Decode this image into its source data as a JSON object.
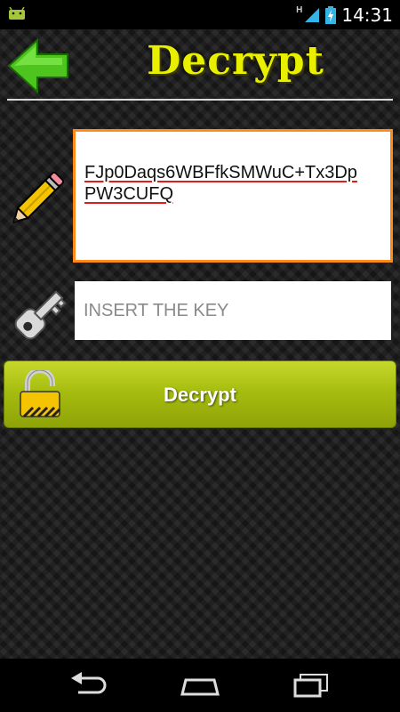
{
  "status_bar": {
    "network_type": "H",
    "time": "14:31",
    "icons": [
      "android-icon",
      "signal-icon",
      "battery-charging-icon"
    ]
  },
  "header": {
    "title": "Decrypt",
    "back_icon": "back-arrow-icon"
  },
  "cipher": {
    "icon": "pencil-icon",
    "lines": [
      "FJp0Daqs6WBFfkSMWuC+Tx3Dp",
      "PW3CUFQ"
    ]
  },
  "key": {
    "icon": "key-icon",
    "value": "",
    "placeholder": "INSERT THE KEY"
  },
  "decrypt_button": {
    "label": "Decrypt",
    "icon": "padlock-open-icon"
  },
  "nav_bar": {
    "items": [
      "back-icon",
      "home-icon",
      "recent-apps-icon"
    ]
  },
  "colors": {
    "title": "#e8f000",
    "accent_border": "#ff8a1c",
    "button": "#a6bd0f",
    "spell_underline": "#e41b1b"
  }
}
